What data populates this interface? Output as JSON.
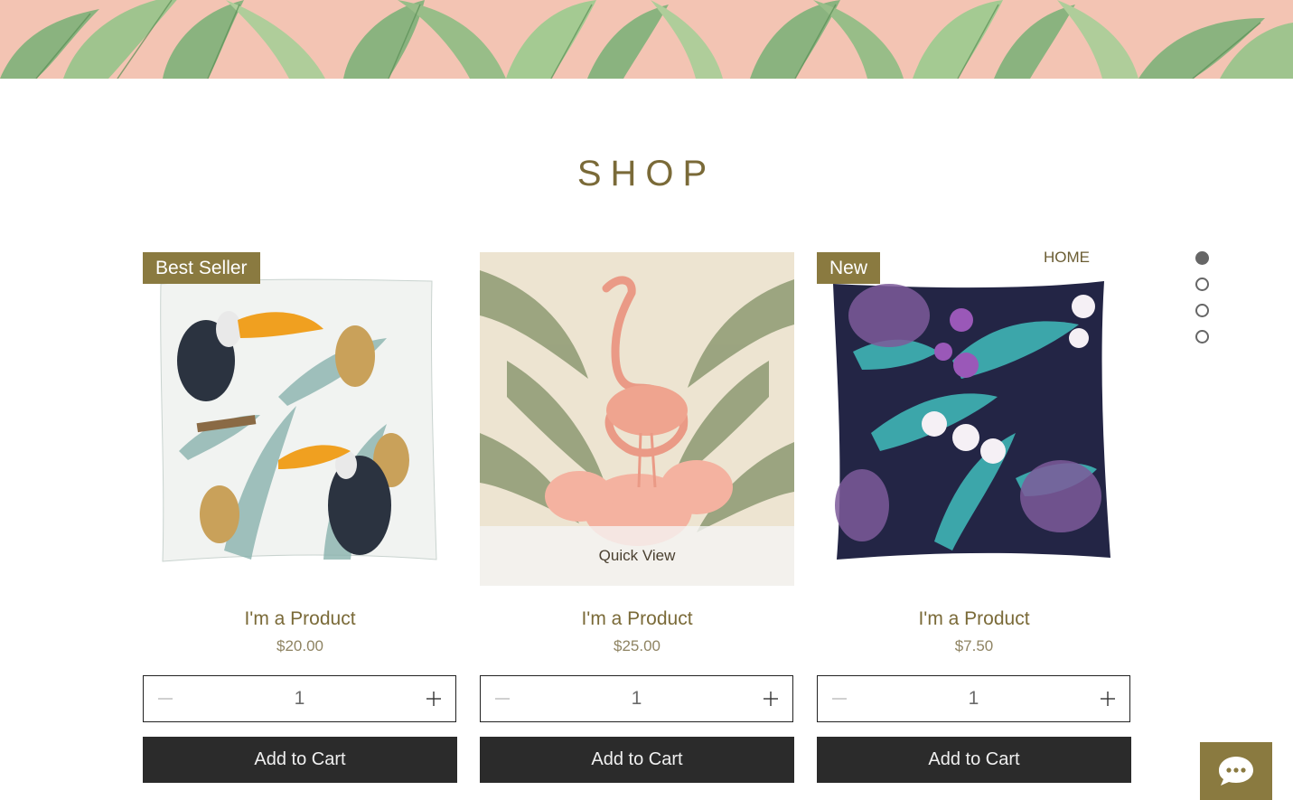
{
  "page": {
    "title": "SHOP"
  },
  "side_nav": {
    "items": [
      {
        "label": "HOME",
        "active": true
      },
      {
        "label": "",
        "active": false
      },
      {
        "label": "",
        "active": false
      },
      {
        "label": "",
        "active": false
      }
    ]
  },
  "products": [
    {
      "ribbon": "Best Seller",
      "name": "I'm a Product",
      "price": "$20.00",
      "quantity": "1",
      "add_to_cart": "Add to Cart",
      "quick_view": ""
    },
    {
      "ribbon": "",
      "name": "I'm a Product",
      "price": "$25.00",
      "quantity": "1",
      "add_to_cart": "Add to Cart",
      "quick_view": "Quick View"
    },
    {
      "ribbon": "New",
      "name": "I'm a Product",
      "price": "$7.50",
      "quantity": "1",
      "add_to_cart": "Add to Cart",
      "quick_view": ""
    }
  ],
  "colors": {
    "accent": "#8a7a40",
    "button_dark": "#2b2b2b",
    "banner_bg": "#f2c2b0"
  },
  "icons": {
    "minus": "minus-icon",
    "plus": "plus-icon",
    "chat": "chat-bubble-icon"
  }
}
